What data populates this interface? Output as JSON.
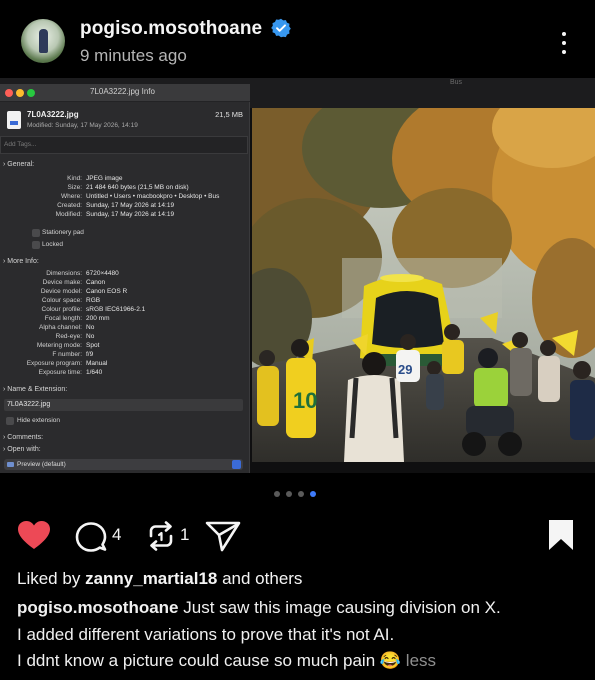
{
  "post": {
    "username": "pogiso.mosothoane",
    "time": "9 minutes ago"
  },
  "photo": {
    "top_label": "Bus",
    "jersey_10": "10",
    "jersey_29": "29"
  },
  "info_window": {
    "title": "7L0A3222.jpg Info",
    "file_name": "7L0A3222.jpg",
    "file_size": "21,5 MB",
    "modified": "Modified: Sunday, 17 May 2026, 14:19",
    "tags_placeholder": "Add Tags...",
    "general_header": "General:",
    "general": [
      {
        "k": "Kind:",
        "v": "JPEG image"
      },
      {
        "k": "Size:",
        "v": "21 484 640 bytes (21,5 MB on disk)"
      },
      {
        "k": "Where:",
        "v": "Untitled • Users • macbookpro • Desktop • Bus"
      },
      {
        "k": "Created:",
        "v": "Sunday, 17 May 2026 at 14:19"
      },
      {
        "k": "Modified:",
        "v": "Sunday, 17 May 2026 at 14:19"
      }
    ],
    "stationery": "Stationery pad",
    "locked": "Locked",
    "more_header": "More Info:",
    "more": [
      {
        "k": "Dimensions:",
        "v": "6720×4480"
      },
      {
        "k": "Device make:",
        "v": "Canon"
      },
      {
        "k": "Device model:",
        "v": "Canon EOS R"
      },
      {
        "k": "Colour space:",
        "v": "RGB"
      },
      {
        "k": "Colour profile:",
        "v": "sRGB IEC61966-2.1"
      },
      {
        "k": "Focal length:",
        "v": "200 mm"
      },
      {
        "k": "Alpha channel:",
        "v": "No"
      },
      {
        "k": "Red-eye:",
        "v": "No"
      },
      {
        "k": "Metering mode:",
        "v": "Spot"
      },
      {
        "k": "F number:",
        "v": "f/9"
      },
      {
        "k": "Exposure program:",
        "v": "Manual"
      },
      {
        "k": "Exposure time:",
        "v": "1/640"
      }
    ],
    "name_header": "Name & Extension:",
    "name_value": "7L0A3222.jpg",
    "hide_extension": "Hide extension",
    "comments_header": "Comments:",
    "open_with_header": "Open with:",
    "open_with_value": "Preview (default)"
  },
  "carousel": {
    "count": 4,
    "active": 3
  },
  "actions": {
    "comment_count": "4",
    "repost_count": "1",
    "like_color": "#ed4956"
  },
  "likes": {
    "prefix": "Liked by",
    "user": "zanny_martial18",
    "suffix": "and others"
  },
  "caption": {
    "username": "pogiso.mosothoane",
    "line1": "Just saw this image causing division on X.",
    "line2": "I added different variations to prove that it's not AI.",
    "line3": "I ddnt know a picture could cause so much pain",
    "emoji": "😂",
    "less": "less"
  },
  "colors": {
    "verified": "#3797f0",
    "accent": "#3e7bfa"
  }
}
